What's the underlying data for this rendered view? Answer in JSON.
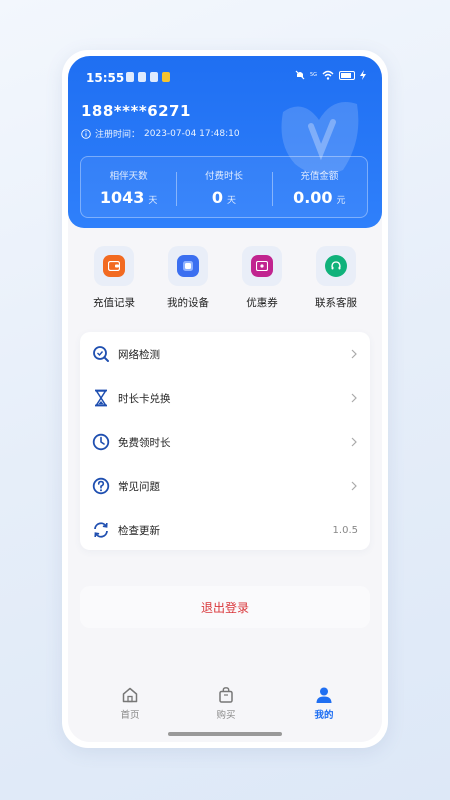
{
  "status_bar": {
    "time": "15:55",
    "network": "5G"
  },
  "profile": {
    "phone": "188****6271",
    "register_label": "注册时间：",
    "register_time": "2023-07-04 17:48:10"
  },
  "stats": [
    {
      "label": "相伴天数",
      "value": "1043",
      "unit": "天"
    },
    {
      "label": "付费时长",
      "value": "0",
      "unit": "天"
    },
    {
      "label": "充值金额",
      "value": "0.00",
      "unit": "元"
    }
  ],
  "quick_actions": [
    {
      "label": "充值记录",
      "icon": "wallet-icon",
      "color": "#f26a21"
    },
    {
      "label": "我的设备",
      "icon": "device-icon",
      "color": "#3b6ff0"
    },
    {
      "label": "优惠券",
      "icon": "coupon-icon",
      "color": "#c1248f"
    },
    {
      "label": "联系客服",
      "icon": "service-icon",
      "color": "#10b27b"
    }
  ],
  "menu": {
    "items": [
      {
        "label": "网络检测",
        "icon": "search-icon"
      },
      {
        "label": "时长卡兑换",
        "icon": "hourglass-icon"
      },
      {
        "label": "免费领时长",
        "icon": "clock-icon"
      },
      {
        "label": "常见问题",
        "icon": "question-icon"
      },
      {
        "label": "检查更新",
        "icon": "refresh-icon"
      }
    ],
    "version": "1.0.5"
  },
  "logout_label": "退出登录",
  "tabs": [
    {
      "label": "首页",
      "icon": "home-icon",
      "active": false
    },
    {
      "label": "购买",
      "icon": "bag-icon",
      "active": false
    },
    {
      "label": "我的",
      "icon": "user-icon",
      "active": true
    }
  ],
  "colors": {
    "primary": "#1f6ff2",
    "logout": "#d9373b"
  }
}
